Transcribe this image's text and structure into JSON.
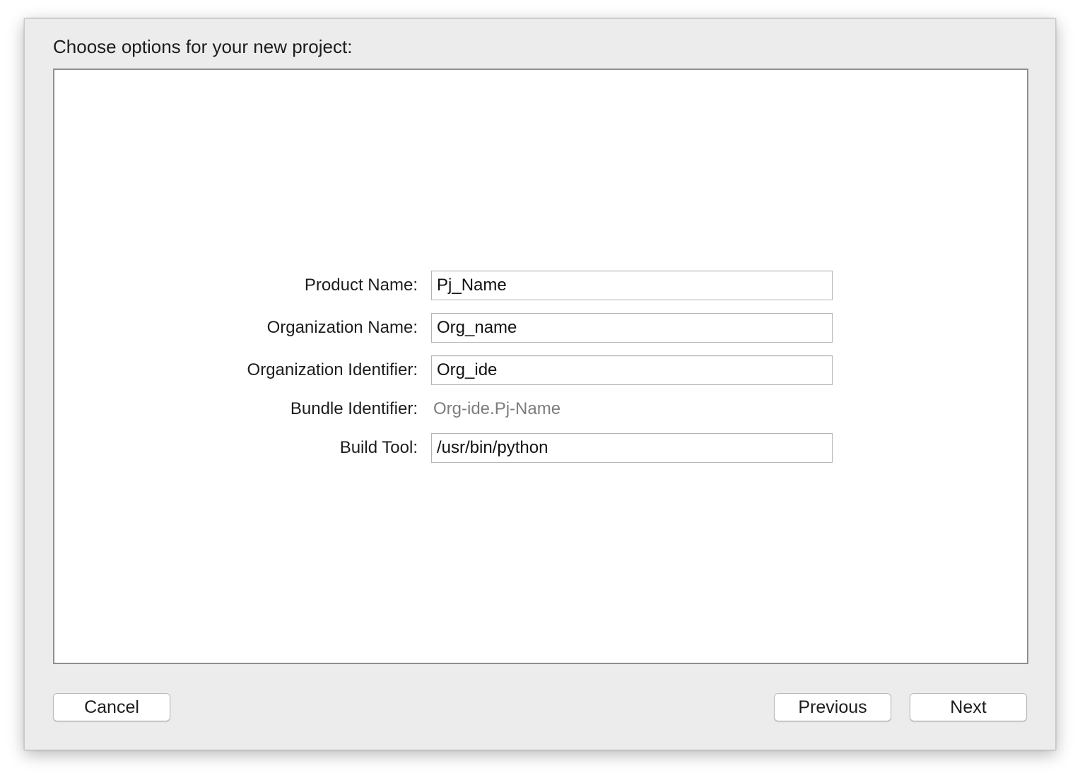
{
  "dialog": {
    "title": "Choose options for your new project:"
  },
  "form": {
    "product_name": {
      "label": "Product Name:",
      "value": "Pj_Name"
    },
    "organization_name": {
      "label": "Organization Name:",
      "value": "Org_name"
    },
    "organization_identifier": {
      "label": "Organization Identifier:",
      "value": "Org_ide"
    },
    "bundle_identifier": {
      "label": "Bundle Identifier:",
      "value": "Org-ide.Pj-Name"
    },
    "build_tool": {
      "label": "Build Tool:",
      "value": "/usr/bin/python"
    }
  },
  "buttons": {
    "cancel": "Cancel",
    "previous": "Previous",
    "next": "Next"
  }
}
